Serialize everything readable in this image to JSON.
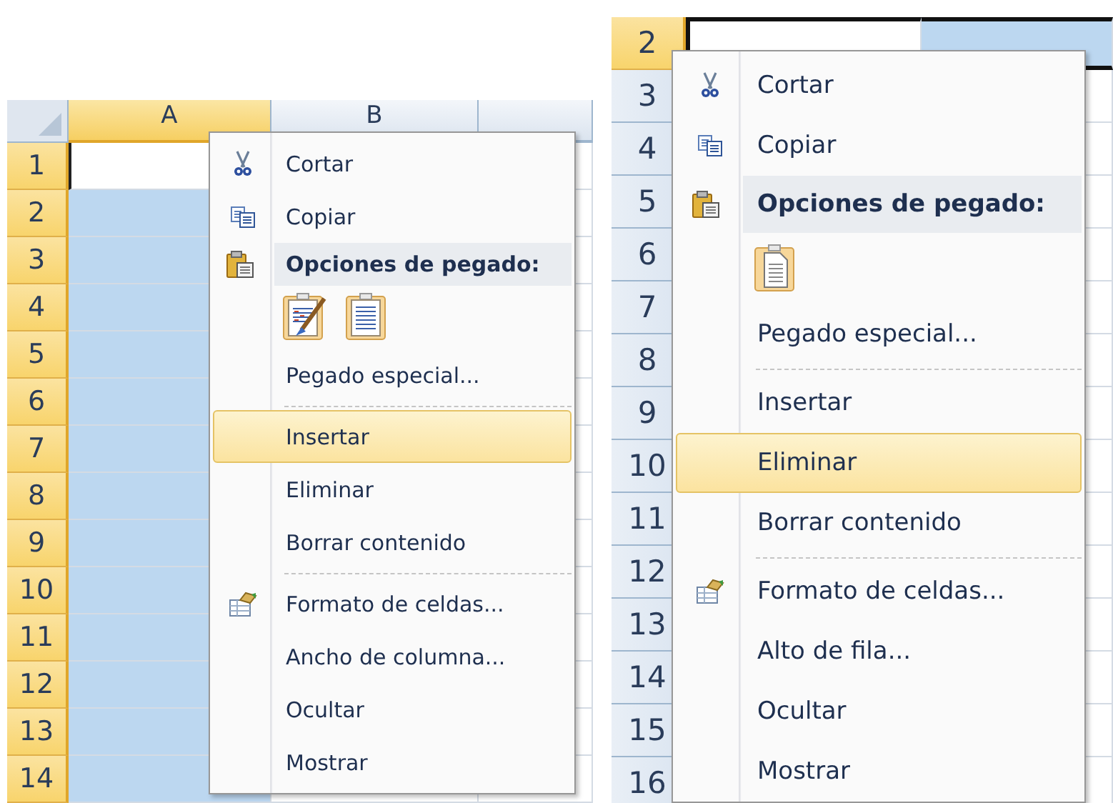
{
  "panels": [
    {
      "columns": [
        {
          "label": "A",
          "selected": true
        },
        {
          "label": "B",
          "selected": false
        },
        {
          "selected": false
        }
      ],
      "rows": [
        {
          "label": "1",
          "selected": true,
          "active": true
        },
        {
          "label": "2",
          "selected": true,
          "active": false
        },
        {
          "label": "3",
          "selected": true,
          "active": false
        },
        {
          "label": "4",
          "selected": true,
          "active": false
        },
        {
          "label": "5",
          "selected": true,
          "active": false
        },
        {
          "label": "6",
          "selected": true,
          "active": false
        },
        {
          "label": "7",
          "selected": true,
          "active": false
        },
        {
          "label": "8",
          "selected": true,
          "active": false
        },
        {
          "label": "9",
          "selected": true,
          "active": false
        },
        {
          "label": "10",
          "selected": true,
          "active": false
        },
        {
          "label": "11",
          "selected": true,
          "active": false
        },
        {
          "label": "12",
          "selected": true,
          "active": false
        },
        {
          "label": "13",
          "selected": true,
          "active": false
        },
        {
          "label": "14",
          "selected": true,
          "active": false
        }
      ],
      "menu": [
        {
          "kind": "cut",
          "label": "Cortar",
          "selected": false
        },
        {
          "kind": "copy",
          "label": "Copiar",
          "selected": false
        },
        {
          "kind": "header",
          "label": "Opciones de pegado:"
        },
        {
          "kind": "paste_options",
          "buttons": [
            {
              "kind": "formatting"
            },
            {
              "kind": "values"
            }
          ]
        },
        {
          "kind": "item",
          "label": "Pegado especial...",
          "selected": false
        },
        {
          "kind": "separator"
        },
        {
          "kind": "item",
          "label": "Insertar",
          "selected": true
        },
        {
          "kind": "item",
          "label": "Eliminar",
          "selected": false
        },
        {
          "kind": "item",
          "label": "Borrar contenido",
          "selected": false
        },
        {
          "kind": "separator"
        },
        {
          "kind": "format",
          "label": "Formato de celdas...",
          "selected": false
        },
        {
          "kind": "item",
          "label": "Ancho de columna...",
          "selected": false
        },
        {
          "kind": "item",
          "label": "Ocultar",
          "selected": false
        },
        {
          "kind": "item",
          "label": "Mostrar",
          "selected": false
        }
      ]
    },
    {
      "rows": [
        {
          "label": "2",
          "selected": true,
          "active": true
        },
        {
          "label": "3",
          "selected": false,
          "active": false
        },
        {
          "label": "4",
          "selected": false,
          "active": false
        },
        {
          "label": "5",
          "selected": false,
          "active": false
        },
        {
          "label": "6",
          "selected": false,
          "active": false
        },
        {
          "label": "7",
          "selected": false,
          "active": false
        },
        {
          "label": "8",
          "selected": false,
          "active": false
        },
        {
          "label": "9",
          "selected": false,
          "active": false
        },
        {
          "label": "10",
          "selected": false,
          "active": false
        },
        {
          "label": "11",
          "selected": false,
          "active": false
        },
        {
          "label": "12",
          "selected": false,
          "active": false
        },
        {
          "label": "13",
          "selected": false,
          "active": false
        },
        {
          "label": "14",
          "selected": false,
          "active": false
        },
        {
          "label": "15",
          "selected": false,
          "active": false
        },
        {
          "label": "16",
          "selected": false,
          "active": false
        }
      ],
      "menu": [
        {
          "kind": "cut",
          "label": "Cortar",
          "selected": false
        },
        {
          "kind": "copy",
          "label": "Copiar",
          "selected": false
        },
        {
          "kind": "header",
          "label": "Opciones de pegado:"
        },
        {
          "kind": "paste_options",
          "buttons": [
            {
              "kind": "document"
            }
          ]
        },
        {
          "kind": "item",
          "label": "Pegado especial...",
          "selected": false
        },
        {
          "kind": "separator"
        },
        {
          "kind": "item",
          "label": "Insertar",
          "selected": false
        },
        {
          "kind": "item",
          "label": "Eliminar",
          "selected": true
        },
        {
          "kind": "item",
          "label": "Borrar contenido",
          "selected": false
        },
        {
          "kind": "separator"
        },
        {
          "kind": "format",
          "label": "Formato de celdas...",
          "selected": false
        },
        {
          "kind": "item",
          "label": "Alto de fila...",
          "selected": false
        },
        {
          "kind": "item",
          "label": "Ocultar",
          "selected": false
        },
        {
          "kind": "item",
          "label": "Mostrar",
          "selected": false
        }
      ]
    }
  ]
}
